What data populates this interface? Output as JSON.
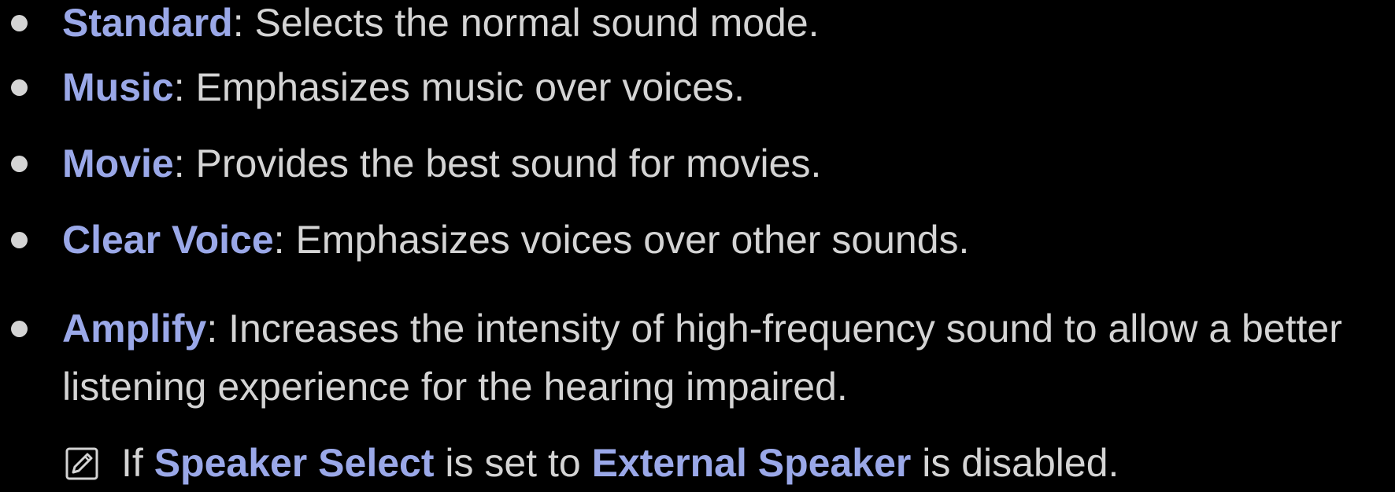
{
  "items": [
    {
      "term": "Standard",
      "sep": ": ",
      "desc": "Selects the normal sound mode."
    },
    {
      "term": "Music",
      "sep": ": ",
      "desc": "Emphasizes music over voices."
    },
    {
      "term": "Movie",
      "sep": ": ",
      "desc": "Provides the best sound for movies."
    },
    {
      "term": "Clear Voice",
      "sep": ": ",
      "desc": "Emphasizes voices over other sounds."
    },
    {
      "term": "Amplify",
      "sep": ": ",
      "desc": "Increases the intensity of high-frequency sound to allow a better",
      "desc_cont": "listening experience for the hearing impaired."
    }
  ],
  "note": {
    "icon": "note-icon",
    "prefix": "If ",
    "term1": "Speaker Select",
    "middle": " is set to ",
    "term2": "External Speaker",
    "suffix": " is disabled."
  },
  "colors": {
    "background": "#000000",
    "text": "#d4d4d4",
    "term": "#9aa8e8"
  }
}
